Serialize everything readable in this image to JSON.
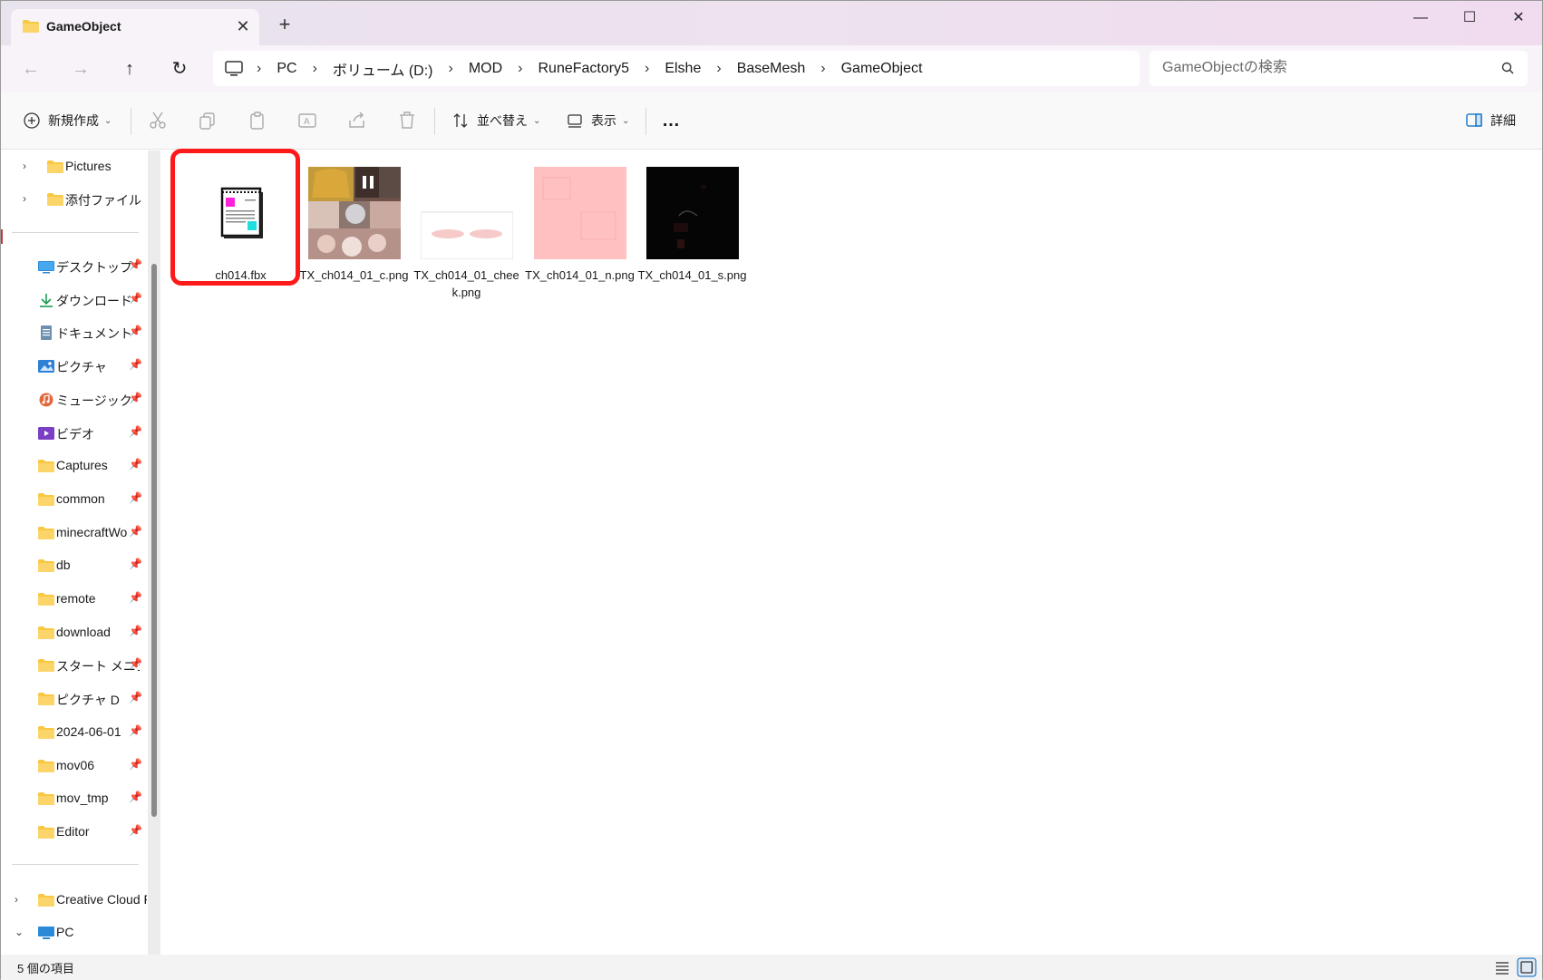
{
  "titlebar": {
    "tab_title": "GameObject",
    "close_tab": "✕",
    "new_tab": "+",
    "minimize": "—",
    "maximize": "☐",
    "close": "✕"
  },
  "nav": {
    "back": "←",
    "forward": "→",
    "up": "↑",
    "refresh": "↻"
  },
  "breadcrumb": [
    "PC",
    "ボリューム (D:)",
    "MOD",
    "RuneFactory5",
    "Elshe",
    "BaseMesh",
    "GameObject"
  ],
  "search": {
    "placeholder": "GameObjectの検索"
  },
  "commandbar": {
    "new_label": "新規作成",
    "sort_label": "並べ替え",
    "view_label": "表示",
    "more_label": "…",
    "details_label": "詳細"
  },
  "sidebar": {
    "top_items": [
      {
        "label": "Pictures",
        "icon": "folder-icon"
      },
      {
        "label": "添付ファイル",
        "icon": "folder-icon"
      }
    ],
    "quick_access": [
      {
        "label": "デスクトップ",
        "icon": "desktop-icon"
      },
      {
        "label": "ダウンロード",
        "icon": "download-icon"
      },
      {
        "label": "ドキュメント",
        "icon": "document-icon"
      },
      {
        "label": "ピクチャ",
        "icon": "pictures-icon"
      },
      {
        "label": "ミュージック",
        "icon": "music-icon"
      },
      {
        "label": "ビデオ",
        "icon": "video-icon"
      },
      {
        "label": "Captures",
        "icon": "folder-icon"
      },
      {
        "label": "common",
        "icon": "folder-icon"
      },
      {
        "label": "minecraftWo",
        "icon": "folder-icon"
      },
      {
        "label": "db",
        "icon": "folder-icon"
      },
      {
        "label": "remote",
        "icon": "folder-icon"
      },
      {
        "label": "download",
        "icon": "folder-icon"
      },
      {
        "label": "スタート メニュ-",
        "icon": "folder-icon"
      },
      {
        "label": "ピクチャ D",
        "icon": "folder-icon"
      },
      {
        "label": "2024-06-01",
        "icon": "folder-icon"
      },
      {
        "label": "mov06",
        "icon": "folder-icon"
      },
      {
        "label": "mov_tmp",
        "icon": "folder-icon"
      },
      {
        "label": "Editor",
        "icon": "folder-icon"
      }
    ],
    "bottom_items": [
      {
        "label": "Creative Cloud F",
        "icon": "folder-icon"
      },
      {
        "label": "PC",
        "icon": "pc-icon"
      }
    ]
  },
  "files": [
    {
      "name": "ch014.fbx",
      "type": "fbx"
    },
    {
      "name": "TX_ch014_01_c.png",
      "type": "texture-color"
    },
    {
      "name": "TX_ch014_01_cheek.png",
      "type": "texture-cheek"
    },
    {
      "name": "TX_ch014_01_n.png",
      "type": "texture-normal"
    },
    {
      "name": "TX_ch014_01_s.png",
      "type": "texture-specular"
    }
  ],
  "status": {
    "item_count": "5 個の項目"
  },
  "colors": {
    "accent": "#0067c0",
    "folder": "#f8c842",
    "highlight": "#ff1a1a"
  }
}
